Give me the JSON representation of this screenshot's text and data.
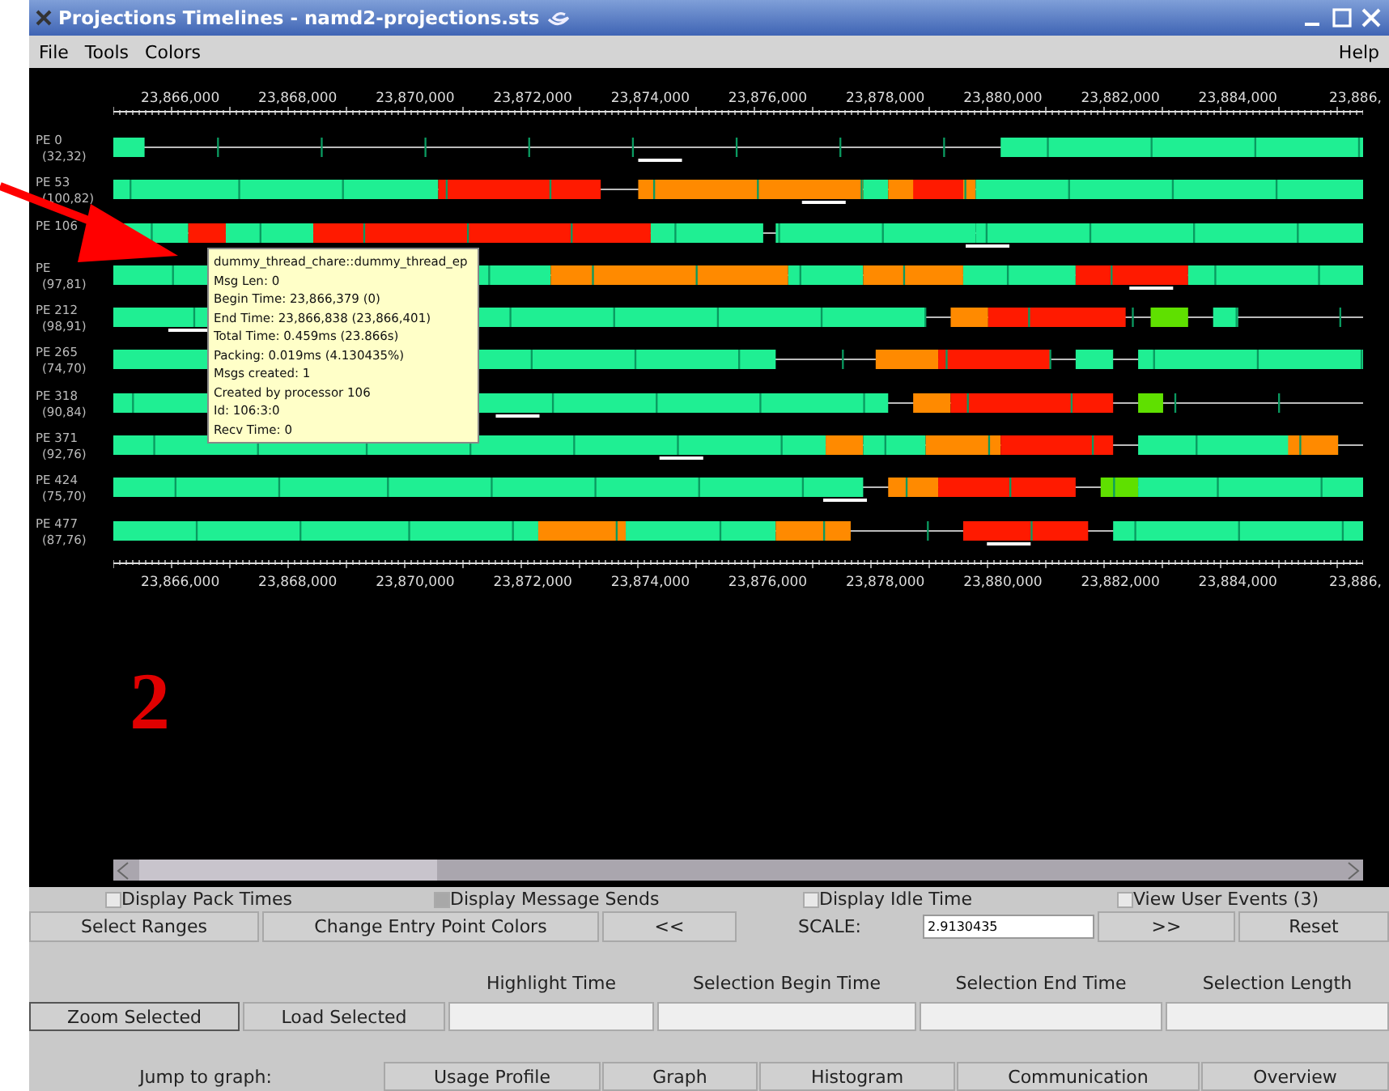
{
  "window": {
    "title": "Projections Timelines - namd2-projections.sts"
  },
  "menu": {
    "left": [
      "File",
      "Tools",
      "Colors"
    ],
    "right": "Help"
  },
  "axis_labels": [
    "23,866,000",
    "23,868,000",
    "23,870,000",
    "23,872,000",
    "23,874,000",
    "23,876,000",
    "23,878,000",
    "23,880,000",
    "23,882,000",
    "23,884,000",
    "23,886,"
  ],
  "rows": [
    {
      "label": "PE 0",
      "sub": "(32,32)"
    },
    {
      "label": "PE 53",
      "sub": "(100,82)"
    },
    {
      "label": "PE 106"
    },
    {
      "label": "PE",
      "sub": "(97,81)"
    },
    {
      "label": "PE 212",
      "sub": "(98,91)"
    },
    {
      "label": "PE 265",
      "sub": "(74,70)"
    },
    {
      "label": "PE 318",
      "sub": "(90,84)"
    },
    {
      "label": "PE 371",
      "sub": "(92,76)"
    },
    {
      "label": "PE 424",
      "sub": "(75,70)"
    },
    {
      "label": "PE 477",
      "sub": "(87,76)"
    }
  ],
  "bottom_axis_labels": [
    "23,866,000",
    "23,868,000",
    "23,870,000",
    "23,872,000",
    "23,874,000",
    "23,876,000",
    "23,878,000",
    "23,880,000",
    "23,882,000",
    "23,884,000",
    "23,886,"
  ],
  "tooltip": {
    "lines": [
      "dummy_thread_chare::dummy_thread_ep",
      "Msg Len: 0",
      "Begin Time: 23,866,379 (0)",
      "End Time: 23,866,838 (23,866,401)",
      "Total Time: 0.459ms (23.866s)",
      "Packing: 0.019ms (4.130435%)",
      "Msgs created: 1",
      "Created by processor 106",
      "Id: 106:3:0",
      "Recv Time: 0"
    ]
  },
  "annotation": "2",
  "checkboxes": [
    {
      "label": "Display Pack Times",
      "checked": false,
      "disabled": false
    },
    {
      "label": "Display Message Sends",
      "checked": false,
      "disabled": true
    },
    {
      "label": "Display Idle Time",
      "checked": false,
      "disabled": false
    },
    {
      "label": "View User Events (3)",
      "checked": false,
      "disabled": false
    }
  ],
  "toolbar": [
    {
      "kind": "button",
      "label": "Select Ranges"
    },
    {
      "kind": "button",
      "label": "Change Entry Point Colors"
    },
    {
      "kind": "button",
      "label": "<<"
    },
    {
      "kind": "label",
      "label": "SCALE:"
    },
    {
      "kind": "field",
      "value": "2.9130435"
    },
    {
      "kind": "button",
      "label": ">>"
    },
    {
      "kind": "button",
      "label": "Reset"
    }
  ],
  "selection": {
    "buttons": [
      {
        "label": "Zoom Selected",
        "selected": true
      },
      {
        "label": "Load Selected",
        "selected": false
      }
    ],
    "fields": [
      {
        "label": "Highlight Time"
      },
      {
        "label": "Selection Begin Time"
      },
      {
        "label": "Selection End Time"
      },
      {
        "label": "Selection Length"
      }
    ]
  },
  "jump": {
    "label": "Jump to graph:",
    "buttons": [
      "Usage Profile",
      "Graph",
      "Histogram",
      "Communication",
      "Overview"
    ]
  }
}
